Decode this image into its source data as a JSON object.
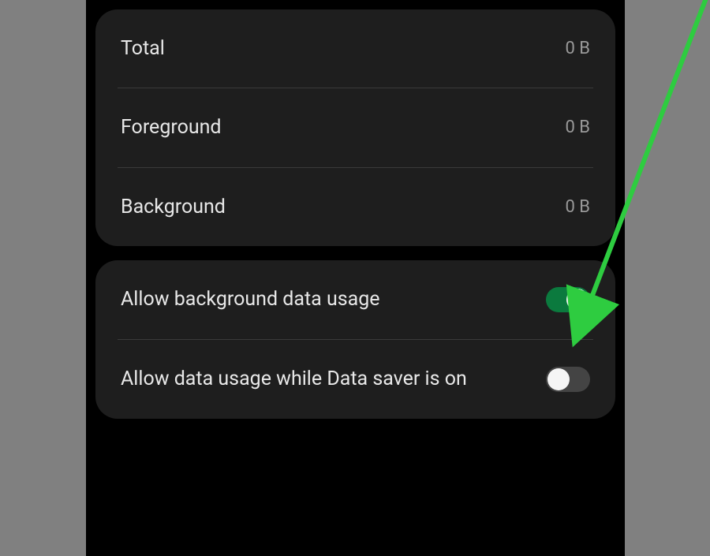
{
  "dataUsage": {
    "rows": [
      {
        "label": "Total",
        "value": "0 B"
      },
      {
        "label": "Foreground",
        "value": "0 B"
      },
      {
        "label": "Background",
        "value": "0 B"
      }
    ]
  },
  "settings": {
    "allowBackgroundData": {
      "label": "Allow background data usage",
      "enabled": true
    },
    "allowDataSaver": {
      "label": "Allow data usage while Data saver is on",
      "enabled": false
    }
  },
  "annotation": {
    "arrowColor": "#2ecc40"
  }
}
